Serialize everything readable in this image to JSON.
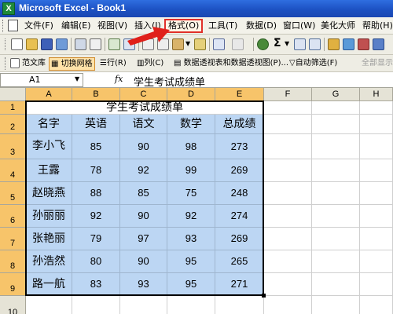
{
  "window": {
    "title": "Microsoft Excel - Book1",
    "app_icon": "X"
  },
  "menu": {
    "items": [
      {
        "label": "文件(F)"
      },
      {
        "label": "编辑(E)"
      },
      {
        "label": "视图(V)"
      },
      {
        "label": "插入(I)"
      },
      {
        "label": "格式(O)"
      },
      {
        "label": "工具(T)"
      },
      {
        "label": "数据(D)"
      },
      {
        "label": "窗口(W)"
      },
      {
        "label": "美化大师"
      },
      {
        "label": "帮助(H)"
      }
    ],
    "highlighted": "格式(O)",
    "highlight_color": "#e0302a"
  },
  "toolbar2": {
    "template_lib": "范文库",
    "toggle_grid": "切换网格",
    "row": "行(R)",
    "col": "列(C)",
    "pivot": "数据透视表和数据透视图(P)...",
    "autofilter": "自动筛选(F)",
    "show_all": "全部显示"
  },
  "formula_bar": {
    "name_box": "A1",
    "fx": "fx",
    "value": "学生考试成绩单"
  },
  "grid": {
    "columns": [
      "A",
      "B",
      "C",
      "D",
      "E",
      "F",
      "G",
      "H"
    ],
    "rows": [
      "1",
      "2",
      "3",
      "4",
      "5",
      "6",
      "7",
      "8",
      "9",
      "10"
    ],
    "title": "学生考试成绩单",
    "headers": [
      "名字",
      "英语",
      "语文",
      "数学",
      "总成绩"
    ],
    "records": [
      [
        "李小飞",
        "85",
        "90",
        "98",
        "273"
      ],
      [
        "王露",
        "78",
        "92",
        "99",
        "269"
      ],
      [
        "赵晓燕",
        "88",
        "85",
        "75",
        "248"
      ],
      [
        "孙丽丽",
        "92",
        "90",
        "92",
        "274"
      ],
      [
        "张艳丽",
        "79",
        "97",
        "93",
        "269"
      ],
      [
        "孙浩然",
        "80",
        "90",
        "95",
        "265"
      ],
      [
        "路一航",
        "83",
        "93",
        "95",
        "271"
      ]
    ],
    "selection_color": "#bcd6f3",
    "header_selected_color": "#f7c46a"
  }
}
